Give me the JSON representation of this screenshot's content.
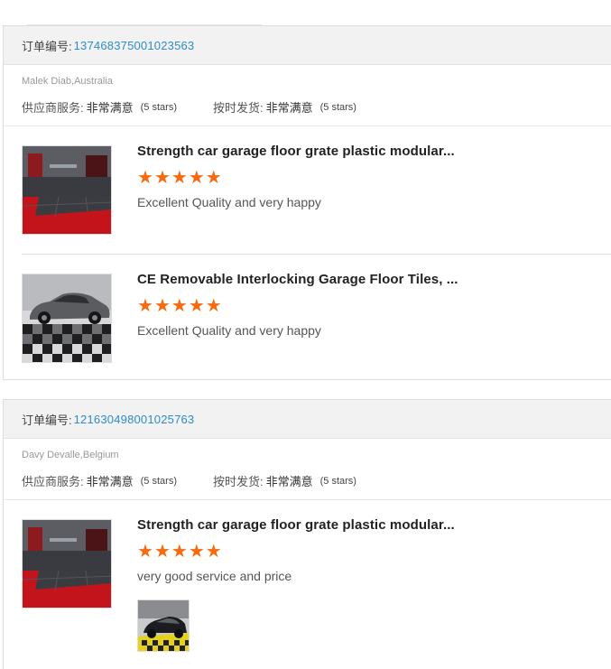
{
  "orders": [
    {
      "order_label": "订单编号:",
      "order_number": "137468375001023563",
      "buyer": "Malek Diab,Australia",
      "supplier_service_label": "供应商服务:",
      "supplier_service_value": "非常满意",
      "supplier_service_stars": "(5 stars)",
      "on_time_label": "按时发货:",
      "on_time_value": "非常满意",
      "on_time_stars": "(5 stars)",
      "items": [
        {
          "title": "Strength car garage floor grate plastic modular...",
          "rating": 5,
          "comment": "Excellent Quality and very happy",
          "image": "garage-red-floor"
        },
        {
          "title": "CE Removable Interlocking Garage Floor Tiles, ...",
          "rating": 5,
          "comment": "Excellent Quality and very happy",
          "image": "car-on-checkered-floor"
        }
      ]
    },
    {
      "order_label": "订单编号:",
      "order_number": "121630498001025763",
      "buyer": "Davy Devalle,Belgium",
      "supplier_service_label": "供应商服务:",
      "supplier_service_value": "非常满意",
      "supplier_service_stars": "(5 stars)",
      "on_time_label": "按时发货:",
      "on_time_value": "非常满意",
      "on_time_stars": "(5 stars)",
      "items": [
        {
          "title": "Strength car garage floor grate plastic modular...",
          "rating": 5,
          "comment": "very good service and price",
          "image": "garage-red-floor",
          "attachment": "car-on-yellow-floor"
        }
      ]
    }
  ],
  "colors": {
    "star": "#f66a10",
    "order_number": "#2d8bc9",
    "header_bg": "#f2f2f2"
  }
}
